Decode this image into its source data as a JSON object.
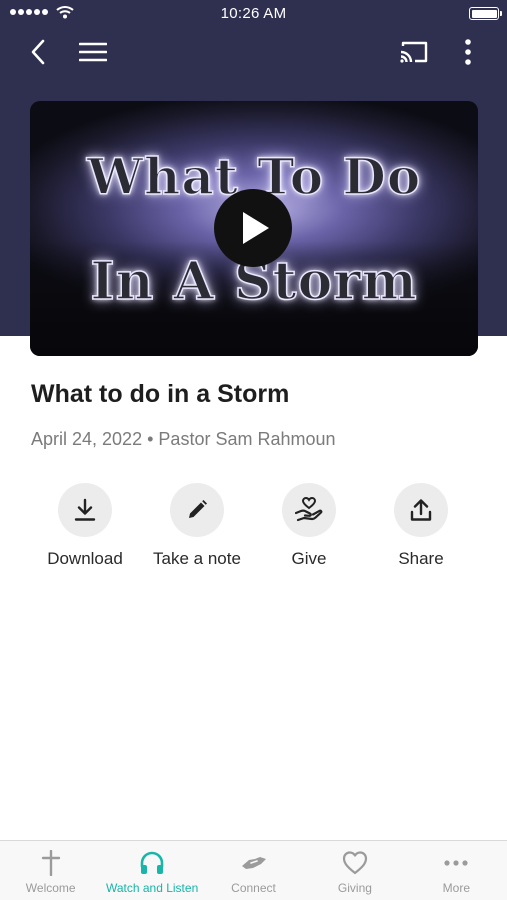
{
  "status_bar": {
    "time": "10:26 AM"
  },
  "video": {
    "title_line1": "What To Do",
    "title_line2": "In A Storm"
  },
  "sermon": {
    "title": "What to do in a Storm",
    "date": "April 24, 2022",
    "separator": "•",
    "speaker": "Pastor Sam Rahmoun"
  },
  "actions": [
    {
      "label": "Download",
      "icon": "download-icon"
    },
    {
      "label": "Take a note",
      "icon": "pencil-icon"
    },
    {
      "label": "Give",
      "icon": "give-heart-hand-icon"
    },
    {
      "label": "Share",
      "icon": "share-icon"
    }
  ],
  "tabs": [
    {
      "label": "Welcome",
      "icon": "cross-icon",
      "active": false
    },
    {
      "label": "Watch and Listen",
      "icon": "headphones-icon",
      "active": true
    },
    {
      "label": "Connect",
      "icon": "handshake-icon",
      "active": false
    },
    {
      "label": "Giving",
      "icon": "heart-icon",
      "active": false
    },
    {
      "label": "More",
      "icon": "more-dots-icon",
      "active": false
    }
  ],
  "colors": {
    "header_bg": "#2f304f",
    "accent": "#18b5a8",
    "tab_inactive": "#9b9b9b"
  }
}
